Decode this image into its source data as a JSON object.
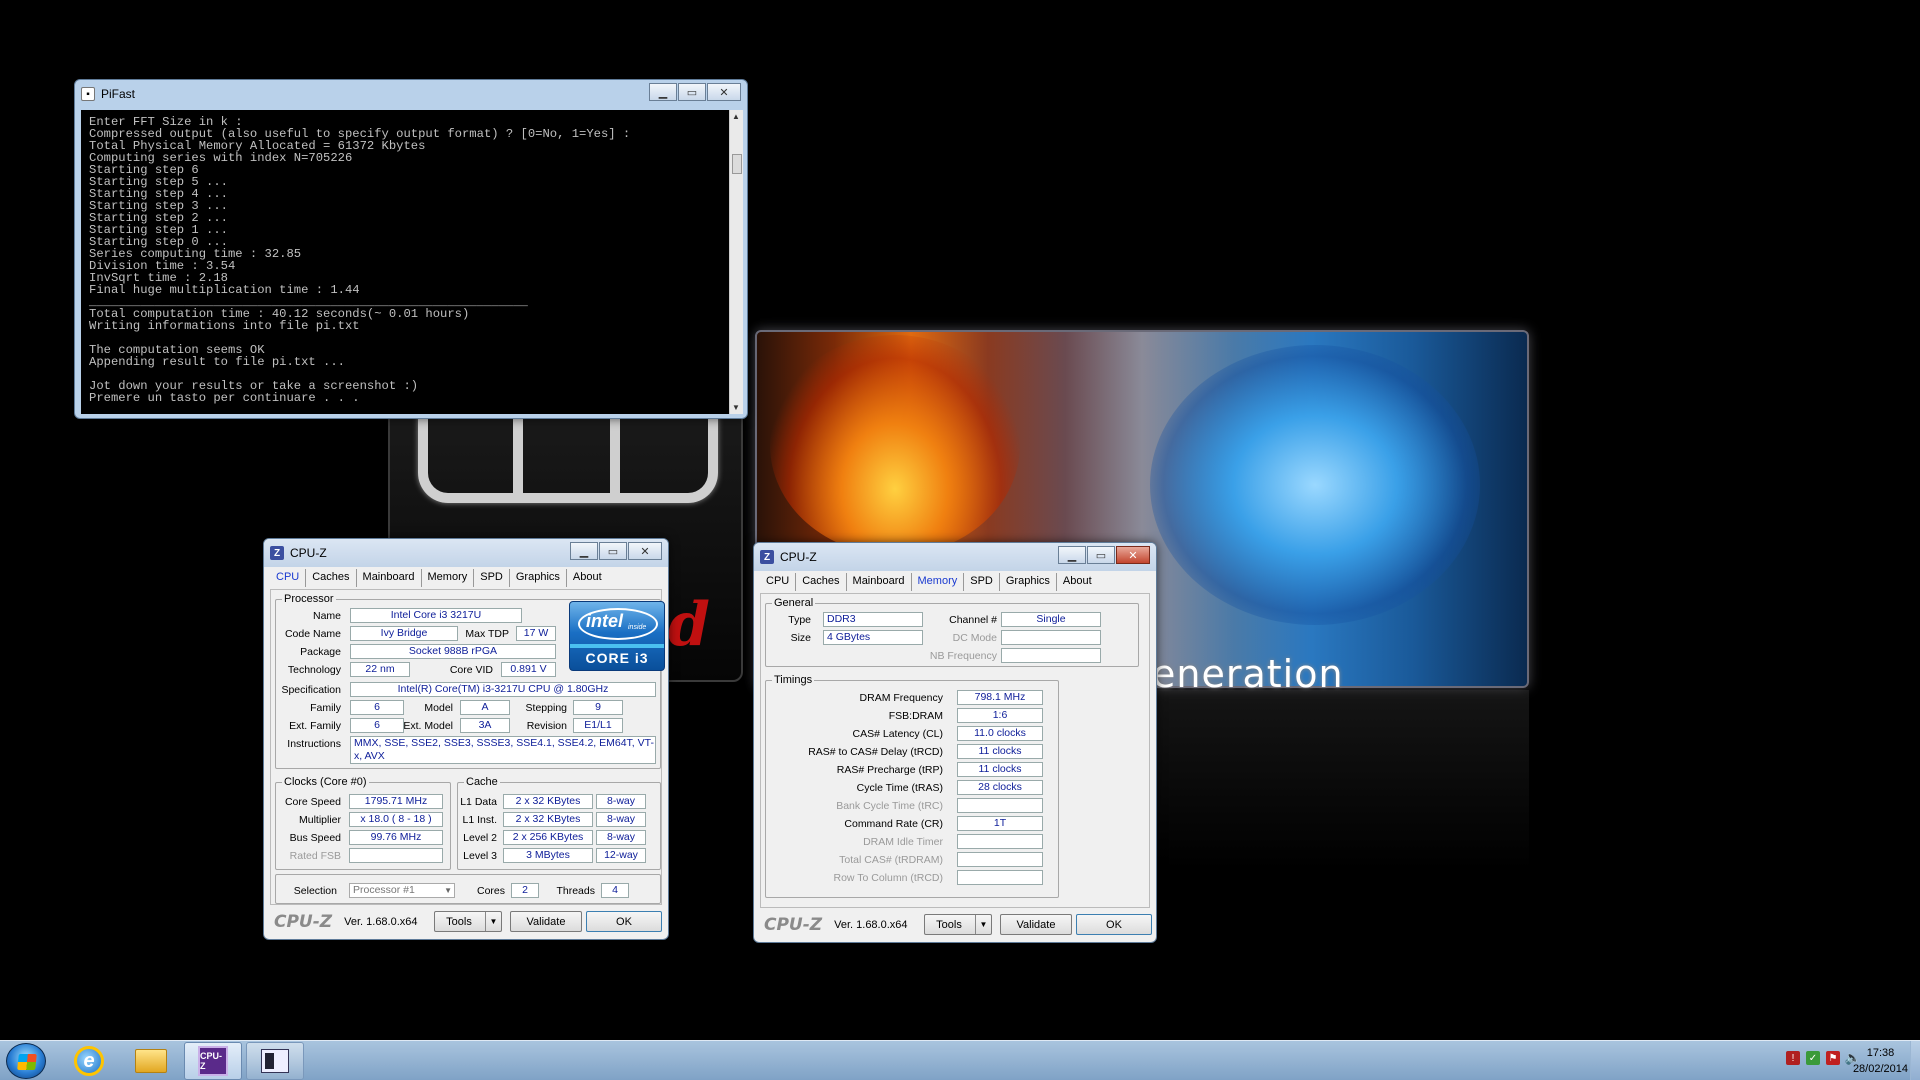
{
  "pifast": {
    "title": "PiFast",
    "lines": [
      "Enter FFT Size in k :",
      "Compressed output (also useful to specify output format) ? [0=No, 1=Yes] :",
      "Total Physical Memory Allocated = 61372 Kbytes",
      "Computing series with index N=705226",
      "Starting step 6",
      "Starting step 5 ...",
      "Starting step 4 ...",
      "Starting step 3 ...",
      "Starting step 2 ...",
      "Starting step 1 ...",
      "Starting step 0 ...",
      "Series computing time : 32.85",
      "Division time : 3.54",
      "InvSqrt time : 2.18",
      "Final huge multiplication time : 1.44",
      "____________________________________________________________",
      "Total computation time : 40.12 seconds(~ 0.01 hours)",
      "Writing informations into file pi.txt",
      "",
      "The computation seems OK",
      "Appending result to file pi.txt ...",
      "",
      "Jot down your results or take a screenshot :)",
      "Premere un tasto per continuare . . ."
    ]
  },
  "wallpaper": {
    "text": "eneration"
  },
  "cpuz_cpu": {
    "title": "CPU-Z",
    "tabs": [
      "CPU",
      "Caches",
      "Mainboard",
      "Memory",
      "SPD",
      "Graphics",
      "About"
    ],
    "active_tab": "CPU",
    "processor_legend": "Processor",
    "labels": {
      "name": "Name",
      "code_name": "Code Name",
      "max_tdp": "Max TDP",
      "package": "Package",
      "technology": "Technology",
      "core_vid": "Core VID",
      "specification": "Specification",
      "family": "Family",
      "model": "Model",
      "stepping": "Stepping",
      "ext_family": "Ext. Family",
      "ext_model": "Ext. Model",
      "revision": "Revision",
      "instructions": "Instructions",
      "core_speed": "Core Speed",
      "multiplier": "Multiplier",
      "bus_speed": "Bus Speed",
      "rated_fsb": "Rated FSB",
      "l1_data": "L1 Data",
      "l1_inst": "L1 Inst.",
      "level2": "Level 2",
      "level3": "Level 3",
      "selection": "Selection",
      "cores": "Cores",
      "threads": "Threads"
    },
    "values": {
      "name": "Intel Core i3 3217U",
      "code_name": "Ivy Bridge",
      "max_tdp": "17 W",
      "package": "Socket 988B rPGA",
      "technology": "22 nm",
      "core_vid": "0.891 V",
      "specification": "Intel(R) Core(TM) i3-3217U CPU @ 1.80GHz",
      "family": "6",
      "model": "A",
      "stepping": "9",
      "ext_family": "6",
      "ext_model": "3A",
      "revision": "E1/L1",
      "instructions": "MMX, SSE, SSE2, SSE3, SSSE3, SSE4.1, SSE4.2, EM64T, VT-x, AVX",
      "core_speed": "1795.71 MHz",
      "multiplier": "x 18.0 ( 8 - 18 )",
      "bus_speed": "99.76 MHz",
      "rated_fsb": "",
      "l1_data": "2 x 32 KBytes",
      "l1_data_way": "8-way",
      "l1_inst": "2 x 32 KBytes",
      "l1_inst_way": "8-way",
      "level2": "2 x 256 KBytes",
      "level2_way": "8-way",
      "level3": "3 MBytes",
      "level3_way": "12-way",
      "selection": "Processor #1",
      "cores": "2",
      "threads": "4"
    },
    "clocks_legend": "Clocks (Core #0)",
    "cache_legend": "Cache",
    "badge": {
      "brand": "intel",
      "inside": "inside",
      "line": "CORE i3"
    },
    "footer": {
      "logo": "CPU-Z",
      "version": "Ver. 1.68.0.x64",
      "tools": "Tools",
      "validate": "Validate",
      "ok": "OK"
    }
  },
  "cpuz_mem": {
    "title": "CPU-Z",
    "tabs": [
      "CPU",
      "Caches",
      "Mainboard",
      "Memory",
      "SPD",
      "Graphics",
      "About"
    ],
    "active_tab": "Memory",
    "general_legend": "General",
    "timings_legend": "Timings",
    "labels": {
      "type": "Type",
      "size": "Size",
      "channel": "Channel #",
      "dc_mode": "DC Mode",
      "nb_freq": "NB Frequency",
      "dram_freq": "DRAM Frequency",
      "fsb_dram": "FSB:DRAM",
      "cas": "CAS# Latency (CL)",
      "rcd": "RAS# to CAS# Delay (tRCD)",
      "rp": "RAS# Precharge (tRP)",
      "ras": "Cycle Time (tRAS)",
      "rc": "Bank Cycle Time (tRC)",
      "cr": "Command Rate (CR)",
      "idle": "DRAM Idle Timer",
      "trdram": "Total CAS# (tRDRAM)",
      "row_col": "Row To Column (tRCD)"
    },
    "values": {
      "type": "DDR3",
      "size": "4 GBytes",
      "channel": "Single",
      "dc_mode": "",
      "nb_freq": "",
      "dram_freq": "798.1 MHz",
      "fsb_dram": "1:6",
      "cas": "11.0 clocks",
      "rcd": "11 clocks",
      "rp": "11 clocks",
      "ras": "28 clocks",
      "rc": "",
      "cr": "1T",
      "idle": "",
      "trdram": "",
      "row_col": ""
    },
    "footer": {
      "logo": "CPU-Z",
      "version": "Ver. 1.68.0.x64",
      "tools": "Tools",
      "validate": "Validate",
      "ok": "OK"
    }
  },
  "taskbar": {
    "apps": [
      "start-orb",
      "internet-explorer",
      "windows-explorer",
      "cpu-z",
      "pifast-console"
    ],
    "clock_time": "17:38",
    "clock_date": "28/02/2014"
  }
}
